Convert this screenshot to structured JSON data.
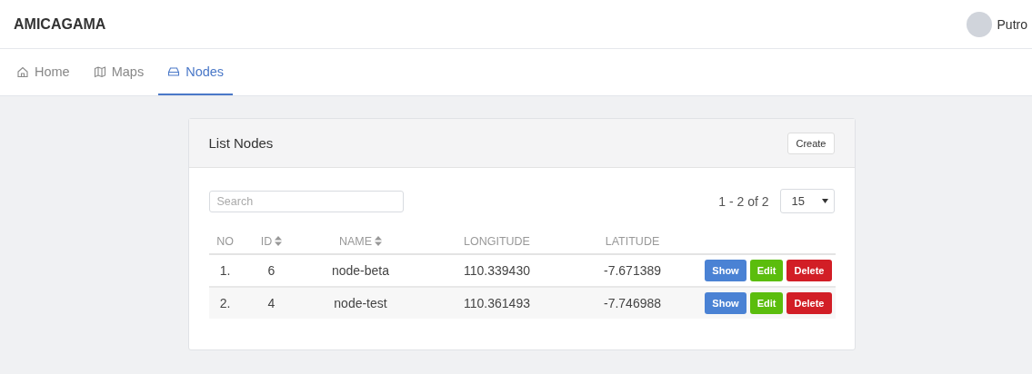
{
  "brand": "AMICAGAMA",
  "user": {
    "name": "Putro"
  },
  "tabs": [
    {
      "label": "Home",
      "selected": false
    },
    {
      "label": "Maps",
      "selected": false
    },
    {
      "label": "Nodes",
      "selected": true
    }
  ],
  "card": {
    "title": "List Nodes",
    "create_button": "Create"
  },
  "search": {
    "placeholder": "Search"
  },
  "pagination": {
    "range": "1 - 2 of 2",
    "per_page": "15"
  },
  "table": {
    "columns": [
      {
        "label": "NO",
        "sortable": false
      },
      {
        "label": "ID",
        "sortable": true
      },
      {
        "label": "NAME",
        "sortable": true
      },
      {
        "label": "LONGITUDE",
        "sortable": false
      },
      {
        "label": "LATITUDE",
        "sortable": false
      }
    ],
    "rows": [
      {
        "no": "1.",
        "id": "6",
        "name": "node-beta",
        "longitude": "110.339430",
        "latitude": "-7.671389",
        "actions": [
          "Show",
          "Edit",
          "Delete"
        ]
      },
      {
        "no": "2.",
        "id": "4",
        "name": "node-test",
        "longitude": "110.361493",
        "latitude": "-7.746988",
        "actions": [
          "Show",
          "Edit",
          "Delete"
        ]
      }
    ]
  }
}
